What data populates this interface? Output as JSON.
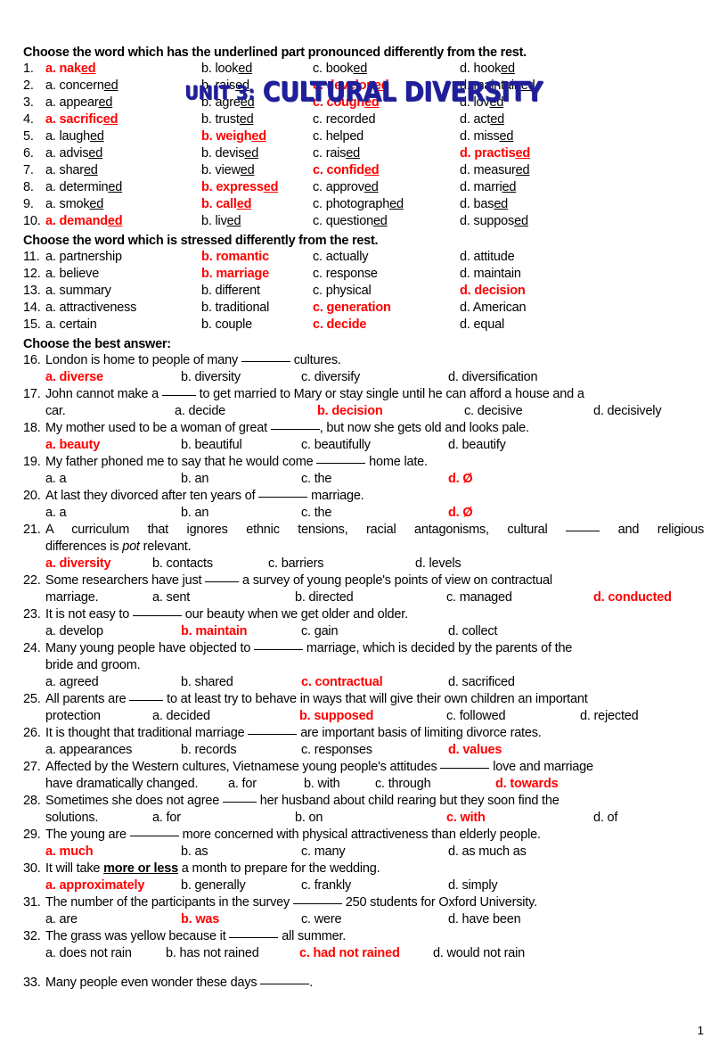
{
  "title": {
    "unit": "UNIT 3:",
    "name": "CULTURAL DIVERSITY",
    "color": "#1f1f9c"
  },
  "accent_color": "#ff0000",
  "headings": {
    "pronunciation": "Choose the word which has the underlined part pronounced differently from the rest.",
    "stress": "Choose the word which is stressed differently from the rest.",
    "best_answer": "Choose the best answer:"
  },
  "pronunciation_questions": [
    {
      "num": "1.",
      "correct": "a",
      "a": {
        "pre": "a. nak",
        "ul": "ed",
        "post": ""
      },
      "b": {
        "pre": "b. look",
        "ul": "ed",
        "post": ""
      },
      "c": {
        "pre": "c. book",
        "ul": "ed",
        "post": ""
      },
      "d": {
        "pre": "d. hook",
        "ul": "ed",
        "post": ""
      }
    },
    {
      "num": "2.",
      "correct": "c",
      "a": {
        "pre": "a. concern",
        "ul": "ed",
        "post": ""
      },
      "b": {
        "pre": "b. rais",
        "ul": "ed",
        "post": ""
      },
      "c": {
        "pre": "c. develop",
        "ul": "ed",
        "post": ""
      },
      "d": {
        "pre": "d. maintain",
        "ul": "ed",
        "post": ""
      }
    },
    {
      "num": "3.",
      "correct": "c",
      "a": {
        "pre": "a. appear",
        "ul": "ed",
        "post": ""
      },
      "b": {
        "pre": "b. agre",
        "ul": "ed",
        "post": ""
      },
      "c": {
        "pre": "c. cough",
        "ul": "ed",
        "post": ""
      },
      "d": {
        "pre": "d. lov",
        "ul": "ed",
        "post": ""
      }
    },
    {
      "num": "4.",
      "correct": "a",
      "a": {
        "pre": "a. sacrific",
        "ul": "ed",
        "post": ""
      },
      "b": {
        "pre": "b. trust",
        "ul": "ed",
        "post": ""
      },
      "c": {
        "pre": "c. recorded",
        "ul": "",
        "post": ""
      },
      "d": {
        "pre": "d. act",
        "ul": "ed",
        "post": ""
      }
    },
    {
      "num": "5.",
      "correct": "b",
      "a": {
        "pre": "a. laugh",
        "ul": "ed",
        "post": ""
      },
      "b": {
        "pre": "b. weigh",
        "ul": "ed",
        "post": ""
      },
      "c": {
        "pre": "c. helped",
        "ul": "",
        "post": ""
      },
      "d": {
        "pre": "d. miss",
        "ul": "ed",
        "post": ""
      }
    },
    {
      "num": "6.",
      "correct": "d",
      "a": {
        "pre": "a. advis",
        "ul": "ed",
        "post": ""
      },
      "b": {
        "pre": "b. devis",
        "ul": "ed",
        "post": ""
      },
      "c": {
        "pre": "c. rais",
        "ul": "ed",
        "post": ""
      },
      "d": {
        "pre": "d. practis",
        "ul": "ed",
        "post": ""
      }
    },
    {
      "num": "7.",
      "correct": "c",
      "a": {
        "pre": "a. shar",
        "ul": "ed",
        "post": ""
      },
      "b": {
        "pre": "b. view",
        "ul": "ed",
        "post": ""
      },
      "c": {
        "pre": "c. confid",
        "ul": "ed",
        "post": ""
      },
      "d": {
        "pre": "d. measur",
        "ul": "ed",
        "post": ""
      }
    },
    {
      "num": "8.",
      "correct": "b",
      "a": {
        "pre": "a. determin",
        "ul": "ed",
        "post": ""
      },
      "b": {
        "pre": "b. express",
        "ul": "ed",
        "post": ""
      },
      "c": {
        "pre": "c. approv",
        "ul": "ed",
        "post": ""
      },
      "d": {
        "pre": "d. marri",
        "ul": "ed",
        "post": ""
      }
    },
    {
      "num": "9.",
      "correct": "b",
      "a": {
        "pre": "a. smok",
        "ul": "ed",
        "post": ""
      },
      "b": {
        "pre": "b. call",
        "ul": "ed",
        "post": ""
      },
      "c": {
        "pre": "c. photograph",
        "ul": "ed",
        "post": ""
      },
      "d": {
        "pre": "d. bas",
        "ul": "ed",
        "post": ""
      }
    },
    {
      "num": "10.",
      "correct": "a",
      "a": {
        "pre": "a. demand",
        "ul": "ed",
        "post": ""
      },
      "b": {
        "pre": "b. liv",
        "ul": "ed",
        "post": ""
      },
      "c": {
        "pre": "c. question",
        "ul": "ed",
        "post": ""
      },
      "d": {
        "pre": "d. suppos",
        "ul": "ed",
        "post": ""
      }
    }
  ],
  "stress_questions": [
    {
      "num": "11.",
      "correct": "b",
      "a": "a. partnership",
      "b": "b. romantic",
      "c": "c. actually",
      "d": "d. attitude"
    },
    {
      "num": "12.",
      "correct": "b",
      "a": "a. believe",
      "b": "b. marriage",
      "c": "c. response",
      "d": "d. maintain"
    },
    {
      "num": "13.",
      "correct": "d",
      "a": "a. summary",
      "b": "b. different",
      "c": "c. physical",
      "d": "d. decision"
    },
    {
      "num": "14.",
      "correct": "c",
      "a": "a. attractiveness",
      "b": "b. traditional",
      "c": "c. generation",
      "d": "d. American"
    },
    {
      "num": "15.",
      "correct": "c",
      "a": "a. certain",
      "b": "b. couple",
      "c": "c. decide",
      "d": "d. equal"
    }
  ],
  "best_answer_questions": {
    "q16": {
      "num": "16.",
      "text_before": "London is home to people of many ",
      "text_after": " cultures.",
      "correct": "a",
      "a": "a. diverse",
      "b": "b. diversity",
      "c": "c. diversify",
      "d": "d. diversification"
    },
    "q17": {
      "num": "17.",
      "line1_a": "John cannot make a ",
      "line1_b": " to get married to Mary or stay single until he can afford a house and a",
      "lead": "car.",
      "correct": "b",
      "a": "a. decide",
      "b": "b. decision",
      "c": "c. decisive",
      "d": "d. decisively"
    },
    "q18": {
      "num": "18.",
      "text_before": "My mother used to be a woman of great ",
      "text_after": ", but now she gets old and looks pale.",
      "correct": "a",
      "a": "a. beauty",
      "b": "b. beautiful",
      "c": "c. beautifully",
      "d": "d. beautify"
    },
    "q19": {
      "num": "19.",
      "text_before": "My father phoned me to say that he would come ",
      "text_after": " home late.",
      "correct": "d",
      "a": "a. a",
      "b": "b. an",
      "c": "c. the",
      "d": "d. Ø"
    },
    "q20": {
      "num": "20.",
      "text_before": "At last they divorced after ten years of ",
      "text_after": " marriage.",
      "correct": "d",
      "a": "a. a",
      "b": "b. an",
      "c": "c. the",
      "d": "d. Ø"
    },
    "q21": {
      "num": "21.",
      "line1_a": "A curriculum that ignores ethnic tensions, racial antagonisms, cultural ",
      "line1_b": " and religious",
      "line2_a": "differences is ",
      "line2_italic": "pot",
      "line2_b": " relevant.",
      "correct": "a",
      "a": "a. diversity",
      "b": "b. contacts",
      "c": "c. barriers",
      "d": "d. levels"
    },
    "q22": {
      "num": "22.",
      "line1_a": "Some researchers have just ",
      "line1_b": " a survey of young people's points of view on contractual",
      "lead": "marriage.",
      "correct": "d",
      "a": "a. sent",
      "b": "b. directed",
      "c": "c. managed",
      "d": "d. conducted"
    },
    "q23": {
      "num": "23.",
      "text_before": "It is not easy to ",
      "text_after": " our beauty when we get older and older.",
      "correct": "b",
      "a": "a. develop",
      "b": "b. maintain",
      "c": "c. gain",
      "d": "d. collect"
    },
    "q24": {
      "num": "24.",
      "line1_a": "Many young people have objected to ",
      "line1_b": " marriage, which is decided by the parents of the",
      "line2": "bride and groom.",
      "correct": "c",
      "a": "a. agreed",
      "b": "b. shared",
      "c": "c. contractual",
      "d": "d. sacrificed"
    },
    "q25": {
      "num": "25.",
      "line1_a": "All parents are ",
      "line1_b": " to at least try to behave in ways that will give their own children an important",
      "lead": "protection",
      "correct": "b",
      "a": "a. decided",
      "b": "b. supposed",
      "c": "c. followed",
      "d": "d. rejected"
    },
    "q26": {
      "num": "26.",
      "text_before": "It is thought that traditional marriage ",
      "text_after": " are important basis of limiting divorce rates.",
      "correct": "d",
      "a": "a. appearances",
      "b": "b. records",
      "c": "c. responses",
      "d": "d. values"
    },
    "q27": {
      "num": "27.",
      "line1_a": "Affected by the Western cultures, Vietnamese young people's attitudes ",
      "line1_b": " love and marriage",
      "lead": "have dramatically changed.",
      "correct": "d",
      "a": "a. for",
      "b": "b. with",
      "c": "c. through",
      "d": "d. towards"
    },
    "q28": {
      "num": "28.",
      "line1_a": "Sometimes she does not agree ",
      "line1_b": " her husband about child rearing but they soon find the",
      "lead": "solutions.",
      "correct": "c",
      "a": "a. for",
      "b": "b. on",
      "c": "c. with",
      "d": "d. of"
    },
    "q29": {
      "num": "29.",
      "text_before": "The young are ",
      "text_after": " more concerned with physical attractiveness than elderly people.",
      "correct": "a",
      "a": "a. much",
      "b": "b. as",
      "c": "c. many",
      "d": "d. as much as"
    },
    "q30": {
      "num": "30.",
      "text_before": "It will take ",
      "emph": "more or less",
      "text_after": " a month to prepare for the wedding.",
      "correct": "a",
      "a": "a. approximately",
      "b": "b. generally",
      "c": "c. frankly",
      "d": "d. simply"
    },
    "q31": {
      "num": "31.",
      "text_before": "The number of the participants in the survey ",
      "text_after": " 250 students for Oxford University.",
      "correct": "b",
      "a": "a. are",
      "b": "b. was",
      "c": "c. were",
      "d": "d. have been"
    },
    "q32": {
      "num": "32.",
      "text_before": "The grass was yellow because it ",
      "text_after": " all summer.",
      "correct": "c",
      "a": "a. does not rain",
      "b": "b. has not rained",
      "c": "c. had not rained",
      "d": "d. would not rain"
    },
    "q33": {
      "num": "33.",
      "text_before": "Many people even wonder these days ",
      "text_after": "."
    }
  },
  "footer": {
    "page_number": "1"
  }
}
